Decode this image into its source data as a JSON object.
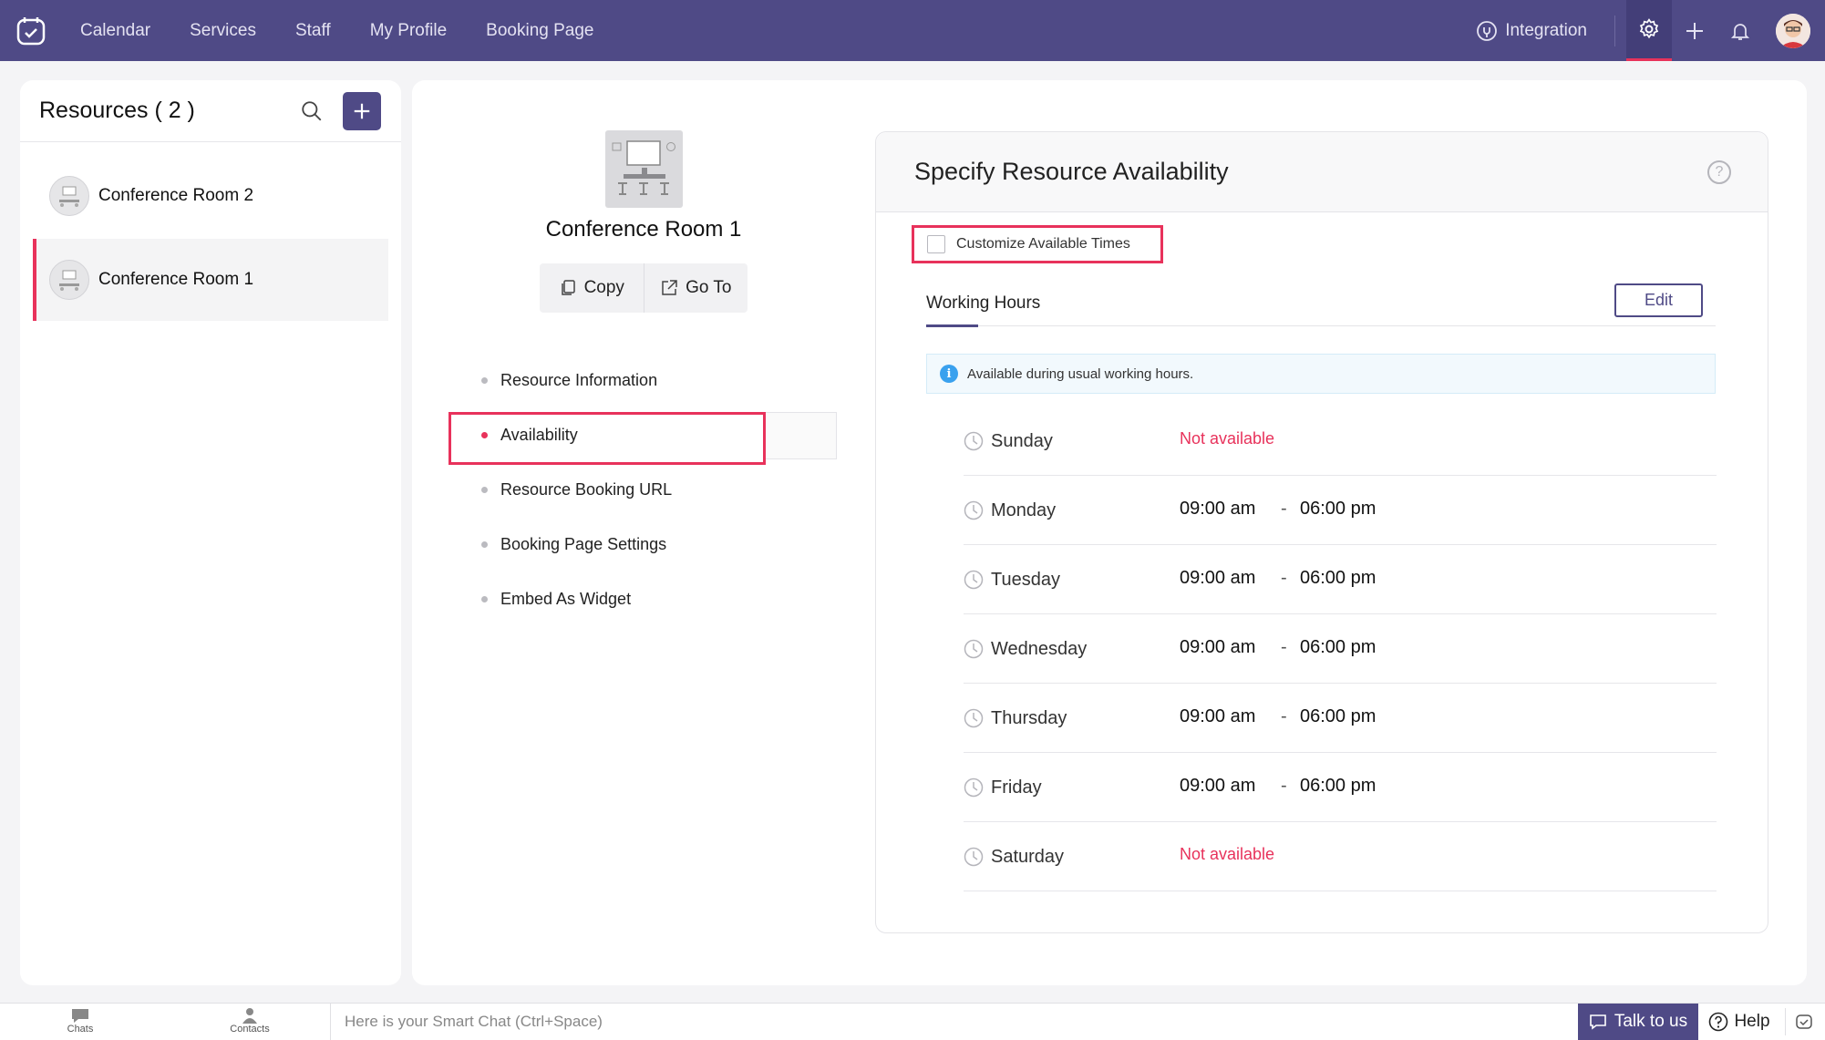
{
  "nav": {
    "links": [
      "Calendar",
      "Services",
      "Staff",
      "My Profile",
      "Booking Page"
    ],
    "integration": "Integration"
  },
  "resources": {
    "title": "Resources ( 2 )",
    "items": [
      {
        "name": "Conference Room 2",
        "active": false
      },
      {
        "name": "Conference Room 1",
        "active": true
      }
    ]
  },
  "detail": {
    "title": "Conference Room 1",
    "copy_label": "Copy",
    "goto_label": "Go To",
    "menu": [
      {
        "label": "Resource Information",
        "active": false
      },
      {
        "label": "Availability",
        "active": true
      },
      {
        "label": "Resource Booking URL",
        "active": false
      },
      {
        "label": "Booking Page Settings",
        "active": false
      },
      {
        "label": "Embed As Widget",
        "active": false
      }
    ]
  },
  "availability": {
    "title": "Specify Resource Availability",
    "help": "?",
    "customize_label": "Customize Available Times",
    "customize_checked": false,
    "working_hours_label": "Working Hours",
    "edit_label": "Edit",
    "info_text": "Available during usual working hours.",
    "info_icon": "i",
    "separator": "-",
    "days": [
      {
        "name": "Sunday",
        "available": false,
        "status": "Not available"
      },
      {
        "name": "Monday",
        "available": true,
        "from": "09:00 am",
        "to": "06:00 pm"
      },
      {
        "name": "Tuesday",
        "available": true,
        "from": "09:00 am",
        "to": "06:00 pm"
      },
      {
        "name": "Wednesday",
        "available": true,
        "from": "09:00 am",
        "to": "06:00 pm"
      },
      {
        "name": "Thursday",
        "available": true,
        "from": "09:00 am",
        "to": "06:00 pm"
      },
      {
        "name": "Friday",
        "available": true,
        "from": "09:00 am",
        "to": "06:00 pm"
      },
      {
        "name": "Saturday",
        "available": false,
        "status": "Not available"
      }
    ]
  },
  "bottombar": {
    "chats_label": "Chats",
    "contacts_label": "Contacts",
    "smart_chat_placeholder": "Here is your Smart Chat (Ctrl+Space)",
    "talk_label": "Talk to us",
    "help_label": "Help"
  },
  "colors": {
    "brand": "#4f4a86",
    "accent": "#e8325b",
    "info": "#3aa1ee"
  },
  "icons": [
    "app-logo-icon",
    "integration-icon",
    "gear-icon",
    "plus-icon",
    "bell-icon",
    "search-icon",
    "copy-icon",
    "external-link-icon",
    "help-circle-icon",
    "info-icon",
    "clock-icon",
    "chat-icon",
    "contacts-icon",
    "question-icon",
    "status-icon"
  ]
}
